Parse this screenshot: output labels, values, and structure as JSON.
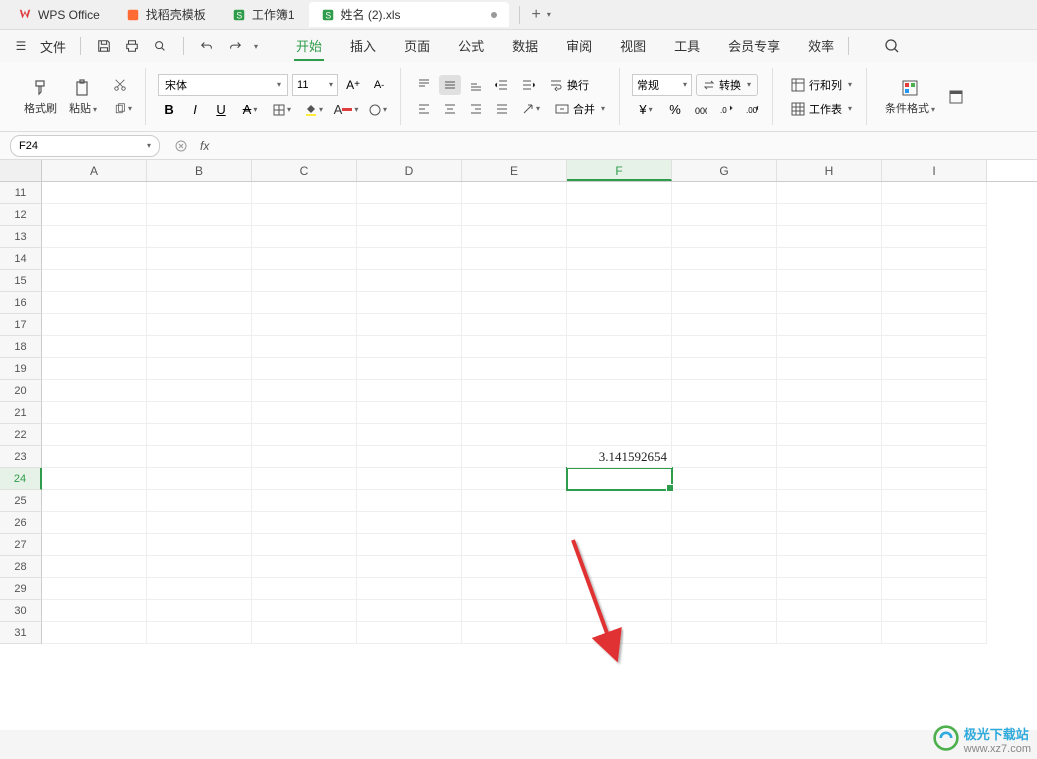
{
  "tabs": {
    "wps": "WPS Office",
    "template": "找稻壳模板",
    "book1": "工作簿1",
    "book2": "姓名 (2).xls"
  },
  "menubar": {
    "file": "文件",
    "items": [
      "开始",
      "插入",
      "页面",
      "公式",
      "数据",
      "审阅",
      "视图",
      "工具",
      "会员专享",
      "效率"
    ]
  },
  "ribbon": {
    "format_painter": "格式刷",
    "paste": "粘贴",
    "font_name": "宋体",
    "font_size": "11",
    "wrap": "换行",
    "merge": "合并",
    "number_format": "常规",
    "convert": "转换",
    "rowcol": "行和列",
    "sheet": "工作表",
    "cond_fmt": "条件格式",
    "bold": "B",
    "italic": "I",
    "underline": "U",
    "strike": "A",
    "font_inc": "A⁺",
    "font_dec": "A⁻"
  },
  "namebox": {
    "cell_ref": "F24"
  },
  "grid": {
    "columns": [
      "A",
      "B",
      "C",
      "D",
      "E",
      "F",
      "G",
      "H",
      "I"
    ],
    "rows_start": 11,
    "rows_end": 31,
    "selected_col": "F",
    "selected_row": 24,
    "cell_value": "3.141592654",
    "value_row": 23,
    "value_col": "F"
  },
  "watermark": {
    "name": "极光下载站",
    "url": "www.xz7.com"
  }
}
